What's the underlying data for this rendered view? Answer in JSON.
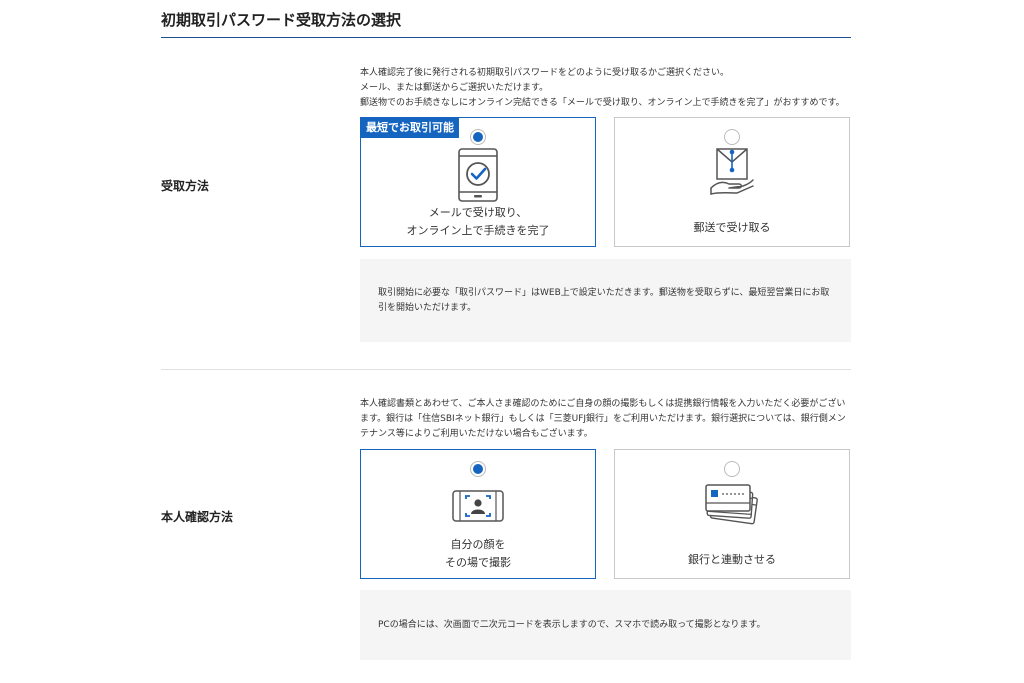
{
  "title": "初期取引パスワード受取方法の選択",
  "receive": {
    "label": "受取方法",
    "desc": [
      "本人確認完了後に発行される初期取引パスワードをどのように受け取るかご選択ください。",
      "メール、または郵送からご選択いただけます。",
      "郵送物でのお手続きなしにオンライン完結できる「メールで受け取り、オンライン上で手続きを完了」がおすすめです。"
    ],
    "option_email": {
      "badge": "最短でお取引可能",
      "label_line1": "メールで受け取り、",
      "label_line2": "オンライン上で手続きを完了",
      "icon": "smartphone-check-icon",
      "selected": true
    },
    "option_mail": {
      "label": "郵送で受け取る",
      "icon": "envelope-hand-icon",
      "selected": false
    },
    "note": "取引開始に必要な「取引パスワード」はWEB上で設定いただきます。郵送物を受取らずに、最短翌営業日にお取引を開始いただけます。"
  },
  "identity": {
    "label": "本人確認方法",
    "desc": "本人確認書類とあわせて、ご本人さま確認のためにご自身の顔の撮影もしくは提携銀行情報を入力いただく必要がございます。銀行は「住信SBIネット銀行」もしくは「三菱UFJ銀行」をご利用いただけます。銀行選択については、銀行側メンテナンス等によりご利用いただけない場合もございます。",
    "option_face": {
      "label_line1": "自分の顔を",
      "label_line2": "その場で撮影",
      "icon": "face-camera-icon",
      "selected": true
    },
    "option_bank": {
      "label": "銀行と連動させる",
      "icon": "bank-card-icon",
      "selected": false
    },
    "note": "PCの場合には、次画面で二次元コードを表示しますので、スマホで読み取って撮影となります。"
  },
  "colors": {
    "accent": "#1565c0",
    "title_rule": "#1c4f8f",
    "note_bg": "#f5f5f5"
  }
}
